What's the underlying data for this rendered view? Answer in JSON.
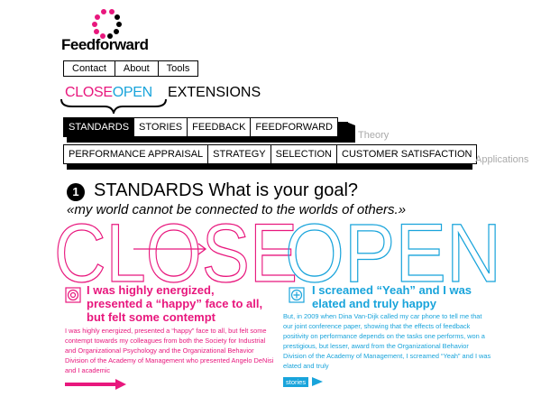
{
  "logo": {
    "text": "Feedforward"
  },
  "topnav": [
    {
      "label": "Contact"
    },
    {
      "label": "About"
    },
    {
      "label": "Tools"
    }
  ],
  "closeopen": {
    "close": "CLOSE",
    "open": "OPEN"
  },
  "extensions_label": "EXTENSIONS",
  "theory_bar": [
    {
      "label": "STANDARDS",
      "active": true
    },
    {
      "label": "STORIES"
    },
    {
      "label": "FEEDBACK"
    },
    {
      "label": "FEEDFORWARD"
    }
  ],
  "theory_label": "Theory",
  "applications_bar": [
    {
      "label": "PERFORMANCE APPRAISAL"
    },
    {
      "label": "STRATEGY"
    },
    {
      "label": "SELECTION"
    },
    {
      "label": "CUSTOMER SATISFACTION"
    }
  ],
  "applications_label": "Applications",
  "section": {
    "number": "1",
    "title": "STANDARDS What is your goal?",
    "quote": "«my world cannot be connected to the worlds of others.»",
    "big_close": "CLOSE",
    "big_open": "OPEN"
  },
  "left_story": {
    "heading": "I was highly energized, presented a “happy” face to all, but felt some contempt",
    "body": "I was highly energized, presented a “happy” face to all, but felt some contempt towards my colleagues from both the Society for Industrial and Organizational Psychology and the Organizational Behavior Division of the Academy of Management who presented Angelo DeNisi and I academic"
  },
  "right_story": {
    "heading": "I screamed “Yeah” and I was elated and truly happy",
    "body": "But, in 2009 when Dina Van-Dijk called my car phone to tell me that our joint conference paper, showing that the effects of feedback positivity on performance depends on the tasks one performs, won a prestigious, but lesser, award from the Organizational Behavior Division of the Academy of Management, I screamed “Yeah” and I was elated and truly",
    "button": "stories"
  },
  "colors": {
    "pink": "#e8177d",
    "blue": "#19a4db"
  }
}
